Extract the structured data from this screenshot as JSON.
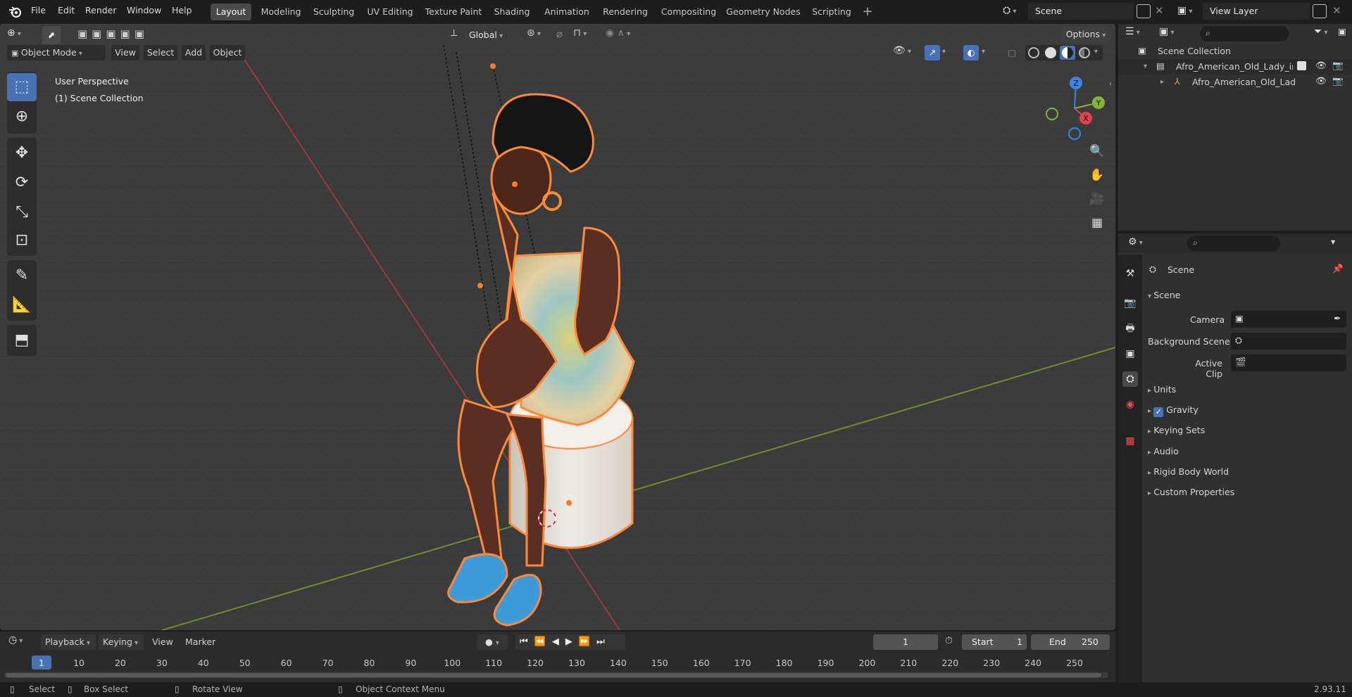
{
  "menu": [
    "File",
    "Edit",
    "Render",
    "Window",
    "Help"
  ],
  "workspaces": [
    "Layout",
    "Modeling",
    "Sculpting",
    "UV Editing",
    "Texture Paint",
    "Shading",
    "Animation",
    "Rendering",
    "Compositing",
    "Geometry Nodes",
    "Scripting"
  ],
  "scene_field": "Scene",
  "view_layer_field": "View Layer",
  "viewport": {
    "transform_orientation": "Global",
    "options_label": "Options",
    "mode": "Object Mode",
    "header_menus": [
      "View",
      "Select",
      "Add",
      "Object"
    ],
    "overlay_line1": "User Perspective",
    "overlay_line2": "(1) Scene Collection",
    "gizmo_axes": {
      "z": "Z",
      "y": "Y",
      "x": "X"
    }
  },
  "outliner": {
    "root": "Scene Collection",
    "collection": "Afro_American_Old_Lady_in_",
    "object": "Afro_American_Old_Lady"
  },
  "properties": {
    "header": "Scene",
    "panel_title": "Scene",
    "camera_label": "Camera",
    "background_scene_label": "Background Scene",
    "active_clip_label": "Active Clip",
    "panels": [
      "Units",
      "Gravity",
      "Keying Sets",
      "Audio",
      "Rigid Body World",
      "Custom Properties"
    ],
    "gravity_checked": true
  },
  "timeline": {
    "menus": [
      "Playback",
      "Keying",
      "View",
      "Marker"
    ],
    "current_frame": "1",
    "start_label": "Start",
    "start_value": "1",
    "end_label": "End",
    "end_value": "250",
    "ruler": [
      "1",
      "10",
      "20",
      "30",
      "40",
      "50",
      "60",
      "70",
      "80",
      "90",
      "100",
      "110",
      "120",
      "130",
      "140",
      "150",
      "160",
      "170",
      "180",
      "190",
      "200",
      "210",
      "220",
      "230",
      "240",
      "250"
    ]
  },
  "status": {
    "select": "Select",
    "box_select": "Box Select",
    "rotate_view": "Rotate View",
    "context_menu": "Object Context Menu",
    "version": "2.93.11"
  },
  "colors": {
    "accent": "#4772b3",
    "selection_outline": "#ff8a3c",
    "x_axis": "#e0424f",
    "y_axis": "#7fb735",
    "z_axis": "#3a85e8"
  }
}
